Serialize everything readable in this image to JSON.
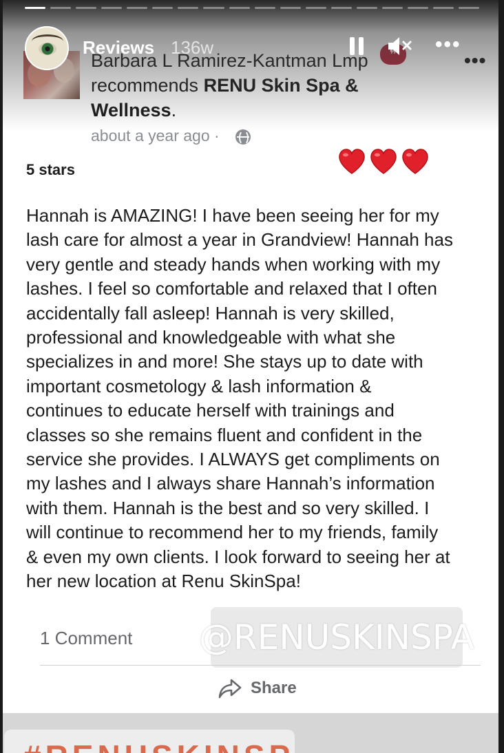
{
  "story": {
    "title": "Reviews",
    "age": "136w",
    "progress": {
      "segments": 18,
      "active_index": 0
    }
  },
  "review": {
    "author": "Barbara L Ramirez-Kantman Lmp",
    "recommends_word": "recommends",
    "business": "RENU Skin Spa & Wellness",
    "period": ".",
    "time": "about a year ago",
    "separator": "·",
    "rating": "5 stars",
    "hearts": 3,
    "body": "Hannah is AMAZING! I have been seeing her for my\nlash care for almost a year in Grandview! Hannah has\nvery gentle and steady hands when working with my\nlashes. I feel so comfortable and relaxed that I often\naccidentally fall asleep! Hannah is very skilled,\nprofessional and knowledgeable with what she\nspecializes in and more! She stays up to date with\nimportant cosmetology & lash information &\ncontinues to educate herself with trainings and\nclasses so she remains fluent and confident in the\nservice she provides. I ALWAYS get compliments on\nmy lashes and I always share Hannah’s information\nwith them. Hannah is the best and so very skilled. I\nwill continue to recommend her to my friends, family\n& even my own clients. I look forward to seeing her at\nher new location at Renu SkinSpa!",
    "comments": "1 Comment",
    "share": "Share"
  },
  "watermark": "@RENUSKINSPA",
  "bottom_band_text": "#RENUSKINSPA",
  "colors": {
    "heart": "#e0202a",
    "badge": "#b0283a",
    "muted": "#8a8d91",
    "text": "#1c1c1c"
  }
}
